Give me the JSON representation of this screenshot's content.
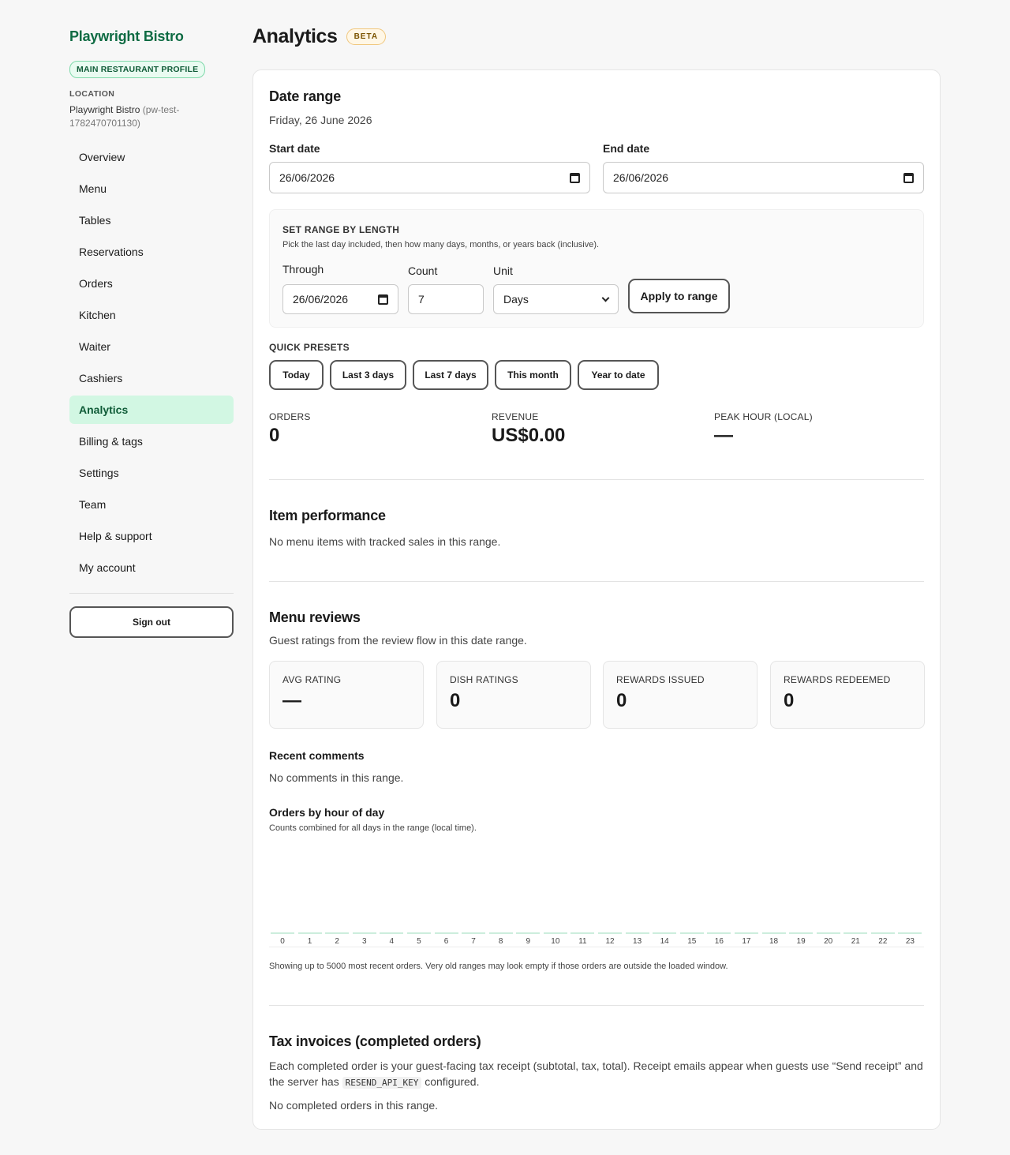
{
  "sidebar": {
    "brand": "Playwright Bistro",
    "profile_badge": "MAIN RESTAURANT PROFILE",
    "location_label": "LOCATION",
    "location_name": "Playwright Bistro",
    "location_id": "(pw-test-1782470701130)",
    "items": [
      {
        "label": "Overview",
        "active": false
      },
      {
        "label": "Menu",
        "active": false
      },
      {
        "label": "Tables",
        "active": false
      },
      {
        "label": "Reservations",
        "active": false
      },
      {
        "label": "Orders",
        "active": false
      },
      {
        "label": "Kitchen",
        "active": false
      },
      {
        "label": "Waiter",
        "active": false
      },
      {
        "label": "Cashiers",
        "active": false
      },
      {
        "label": "Analytics",
        "active": true
      },
      {
        "label": "Billing & tags",
        "active": false
      },
      {
        "label": "Settings",
        "active": false
      },
      {
        "label": "Team",
        "active": false
      },
      {
        "label": "Help & support",
        "active": false
      },
      {
        "label": "My account",
        "active": false
      }
    ],
    "sign_out": "Sign out"
  },
  "header": {
    "title": "Analytics",
    "badge": "BETA"
  },
  "date_range": {
    "title": "Date range",
    "current": "Friday, 26 June 2026",
    "start_label": "Start date",
    "start_value": "26/06/2026",
    "end_label": "End date",
    "end_value": "26/06/2026"
  },
  "range_length": {
    "title": "SET RANGE BY LENGTH",
    "hint": "Pick the last day included, then how many days, months, or years back (inclusive).",
    "through_label": "Through",
    "through_value": "26/06/2026",
    "count_label": "Count",
    "count_value": "7",
    "unit_label": "Unit",
    "unit_value": "Days",
    "apply": "Apply to range"
  },
  "presets": {
    "title": "QUICK PRESETS",
    "items": [
      "Today",
      "Last 3 days",
      "Last 7 days",
      "This month",
      "Year to date"
    ]
  },
  "stats": {
    "orders_label": "ORDERS",
    "orders_value": "0",
    "revenue_label": "REVENUE",
    "revenue_value": "US$0.00",
    "peak_label": "PEAK HOUR (LOCAL)",
    "peak_value": "—"
  },
  "item_performance": {
    "title": "Item performance",
    "empty": "No menu items with tracked sales in this range."
  },
  "menu_reviews": {
    "title": "Menu reviews",
    "subtitle": "Guest ratings from the review flow in this date range.",
    "cards": [
      {
        "label": "AVG RATING",
        "value": "—"
      },
      {
        "label": "DISH RATINGS",
        "value": "0"
      },
      {
        "label": "REWARDS ISSUED",
        "value": "0"
      },
      {
        "label": "REWARDS REDEEMED",
        "value": "0"
      }
    ],
    "comments_title": "Recent comments",
    "comments_empty": "No comments in this range."
  },
  "orders_by_hour": {
    "title": "Orders by hour of day",
    "subtitle": "Counts combined for all days in the range (local time).",
    "note": "Showing up to 5000 most recent orders. Very old ranges may look empty if those orders are outside the loaded window."
  },
  "chart_data": {
    "type": "bar",
    "categories": [
      "0",
      "1",
      "2",
      "3",
      "4",
      "5",
      "6",
      "7",
      "8",
      "9",
      "10",
      "11",
      "12",
      "13",
      "14",
      "15",
      "16",
      "17",
      "18",
      "19",
      "20",
      "21",
      "22",
      "23"
    ],
    "values": [
      0,
      0,
      0,
      0,
      0,
      0,
      0,
      0,
      0,
      0,
      0,
      0,
      0,
      0,
      0,
      0,
      0,
      0,
      0,
      0,
      0,
      0,
      0,
      0
    ],
    "title": "Orders by hour of day",
    "color": "#cdeedd"
  },
  "tax_invoices": {
    "title": "Tax invoices (completed orders)",
    "desc_a": "Each completed order is your guest-facing tax receipt (subtotal, tax, total). Receipt emails appear when guests use “Send receipt” and",
    "desc_b": "the server has",
    "desc_code": "RESEND_API_KEY",
    "desc_c": "configured.",
    "empty": "No completed orders in this range."
  }
}
